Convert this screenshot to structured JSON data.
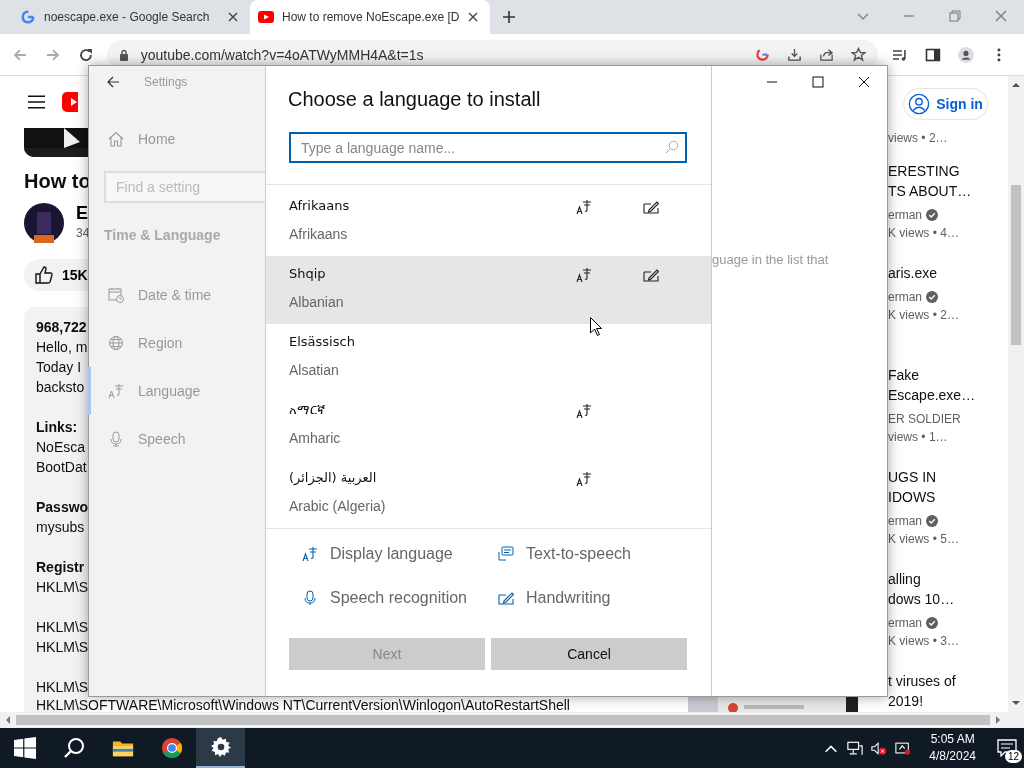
{
  "browser": {
    "tabs": [
      {
        "title": "noescape.exe - Google Search",
        "kind": "google",
        "selected": false
      },
      {
        "title": "How to remove NoEscape.exe [D",
        "kind": "youtube",
        "selected": true
      }
    ],
    "url": "youtube.com/watch?v=4oATWyMMH4A&t=1s"
  },
  "video_page": {
    "title": "How to",
    "channel": "E",
    "subscribers": "34",
    "likes": "15K",
    "description": [
      {
        "lines": [
          {
            "text": "968,722",
            "bold": true
          },
          {
            "text": "Hello, m",
            "bold": false
          },
          {
            "text": "Today I",
            "bold": false
          },
          {
            "text": "backsto",
            "bold": false
          }
        ]
      },
      {
        "lines": [
          {
            "text": "Links:",
            "bold": true
          },
          {
            "text": "NoEsca",
            "bold": false
          },
          {
            "text": "BootDat",
            "bold": false
          }
        ]
      },
      {
        "lines": [
          {
            "text": "Passwo",
            "bold": true
          },
          {
            "text": "mysubs",
            "bold": false
          }
        ]
      },
      {
        "lines": [
          {
            "text": "Registr",
            "bold": true
          },
          {
            "text": "HKLM\\S",
            "bold": false
          }
        ]
      },
      {
        "lines": [
          {
            "text": "HKLM\\S",
            "bold": false
          },
          {
            "text": "HKLM\\S",
            "bold": false
          }
        ]
      },
      {
        "lines": [
          {
            "text": "HKLM\\S",
            "bold": false
          },
          {
            "text": "HKLM\\SOFTWARE\\Microsoft\\Windows NT\\CurrentVersion\\Winlogon\\AutoRestartShell",
            "bold": false
          }
        ]
      }
    ],
    "sign_in": "Sign in",
    "first_meta": "views • 2…",
    "videos": [
      {
        "title_lines": [
          "ERESTING",
          "TS ABOUT…"
        ],
        "channel": "erman",
        "verified": true,
        "meta": "K views • 4…"
      },
      {
        "title_lines": [
          "aris.exe"
        ],
        "channel": "erman",
        "verified": true,
        "meta": "K views • 2…"
      },
      {
        "title_lines": [
          "Fake",
          "Escape.exe…"
        ],
        "channel": "ER SOLDIER",
        "verified": false,
        "meta": "views • 1…"
      },
      {
        "title_lines": [
          "UGS IN",
          "IDOWS"
        ],
        "channel": "erman",
        "verified": true,
        "meta": "K views • 5…"
      },
      {
        "title_lines": [
          "alling",
          "dows 10…"
        ],
        "channel": "erman",
        "verified": true,
        "meta": "K views • 3…"
      },
      {
        "title_lines": [
          "t viruses of",
          "2019!"
        ]
      }
    ]
  },
  "settings": {
    "title": "Settings",
    "home": "Home",
    "search_placeholder": "Find a setting",
    "section": "Time & Language",
    "items": [
      {
        "label": "Date & time",
        "kind": "calendar",
        "selected": false
      },
      {
        "label": "Region",
        "kind": "globe",
        "selected": false
      },
      {
        "label": "Language",
        "kind": "language",
        "selected": true
      },
      {
        "label": "Speech",
        "kind": "microphone",
        "selected": false
      }
    ],
    "hint": "guage in the list that"
  },
  "language_dialog": {
    "title": "Choose a language to install",
    "search_placeholder": "Type a language name...",
    "languages": [
      {
        "name": "Afrikaans",
        "english": "Afrikaans",
        "display": true,
        "handwriting": true,
        "selected": false
      },
      {
        "name": "Shqip",
        "english": "Albanian",
        "display": true,
        "handwriting": true,
        "selected": true
      },
      {
        "name": "Elsässisch",
        "english": "Alsatian",
        "display": false,
        "handwriting": false,
        "selected": false
      },
      {
        "name": "አማርኛ",
        "english": "Amharic",
        "display": true,
        "handwriting": false,
        "selected": false
      },
      {
        "name": "العربية (الجزائر)",
        "english": "Arabic (Algeria)",
        "display": true,
        "handwriting": false,
        "selected": false
      }
    ],
    "legend": [
      {
        "label": "Display language",
        "kind": "display"
      },
      {
        "label": "Text-to-speech",
        "kind": "tts"
      },
      {
        "label": "Speech recognition",
        "kind": "speech"
      },
      {
        "label": "Handwriting",
        "kind": "handwriting"
      }
    ],
    "buttons": [
      {
        "label": "Next",
        "disabled": true
      },
      {
        "label": "Cancel",
        "disabled": false
      }
    ]
  },
  "taskbar": {
    "apps": [
      {
        "kind": "start",
        "selected": false
      },
      {
        "kind": "search",
        "selected": false
      },
      {
        "kind": "explorer",
        "selected": false
      },
      {
        "kind": "chrome",
        "selected": false
      },
      {
        "kind": "settings",
        "selected": true
      }
    ],
    "time": "5:05 AM",
    "date": "4/8/2024",
    "notifications": "12"
  }
}
